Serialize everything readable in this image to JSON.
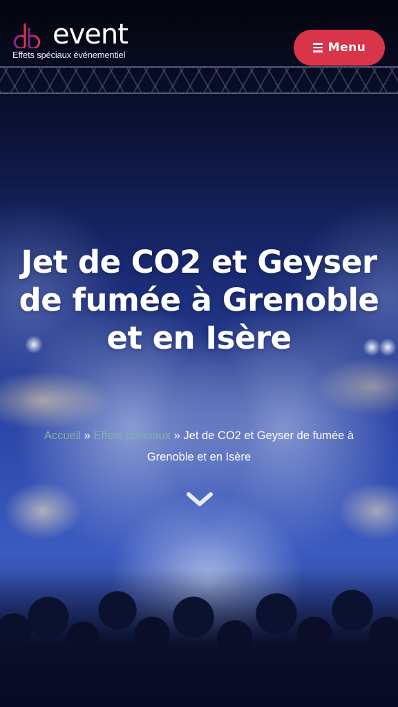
{
  "header": {
    "logo": {
      "wordmark": "event",
      "tagline": "Effets spéciaux événementiel",
      "mark_colors": [
        "#7a2a8a",
        "#d8354a"
      ]
    },
    "menu_button": {
      "label": "Menu",
      "icon": "hamburger-icon",
      "color": "#d8354a"
    }
  },
  "hero": {
    "title": "Jet de CO2 et Geyser de fumée à Grenoble et en Isère",
    "breadcrumb": {
      "items": [
        {
          "label": "Accueil",
          "link": true
        },
        {
          "label": "Effets spéciaux",
          "link": true
        },
        {
          "label": "Jet de CO2 et Geyser de fumée à Grenoble et en Isère",
          "link": false
        }
      ],
      "separator": "»",
      "link_color": "#7fb3a4"
    },
    "scroll_icon": "chevron-down-icon"
  }
}
